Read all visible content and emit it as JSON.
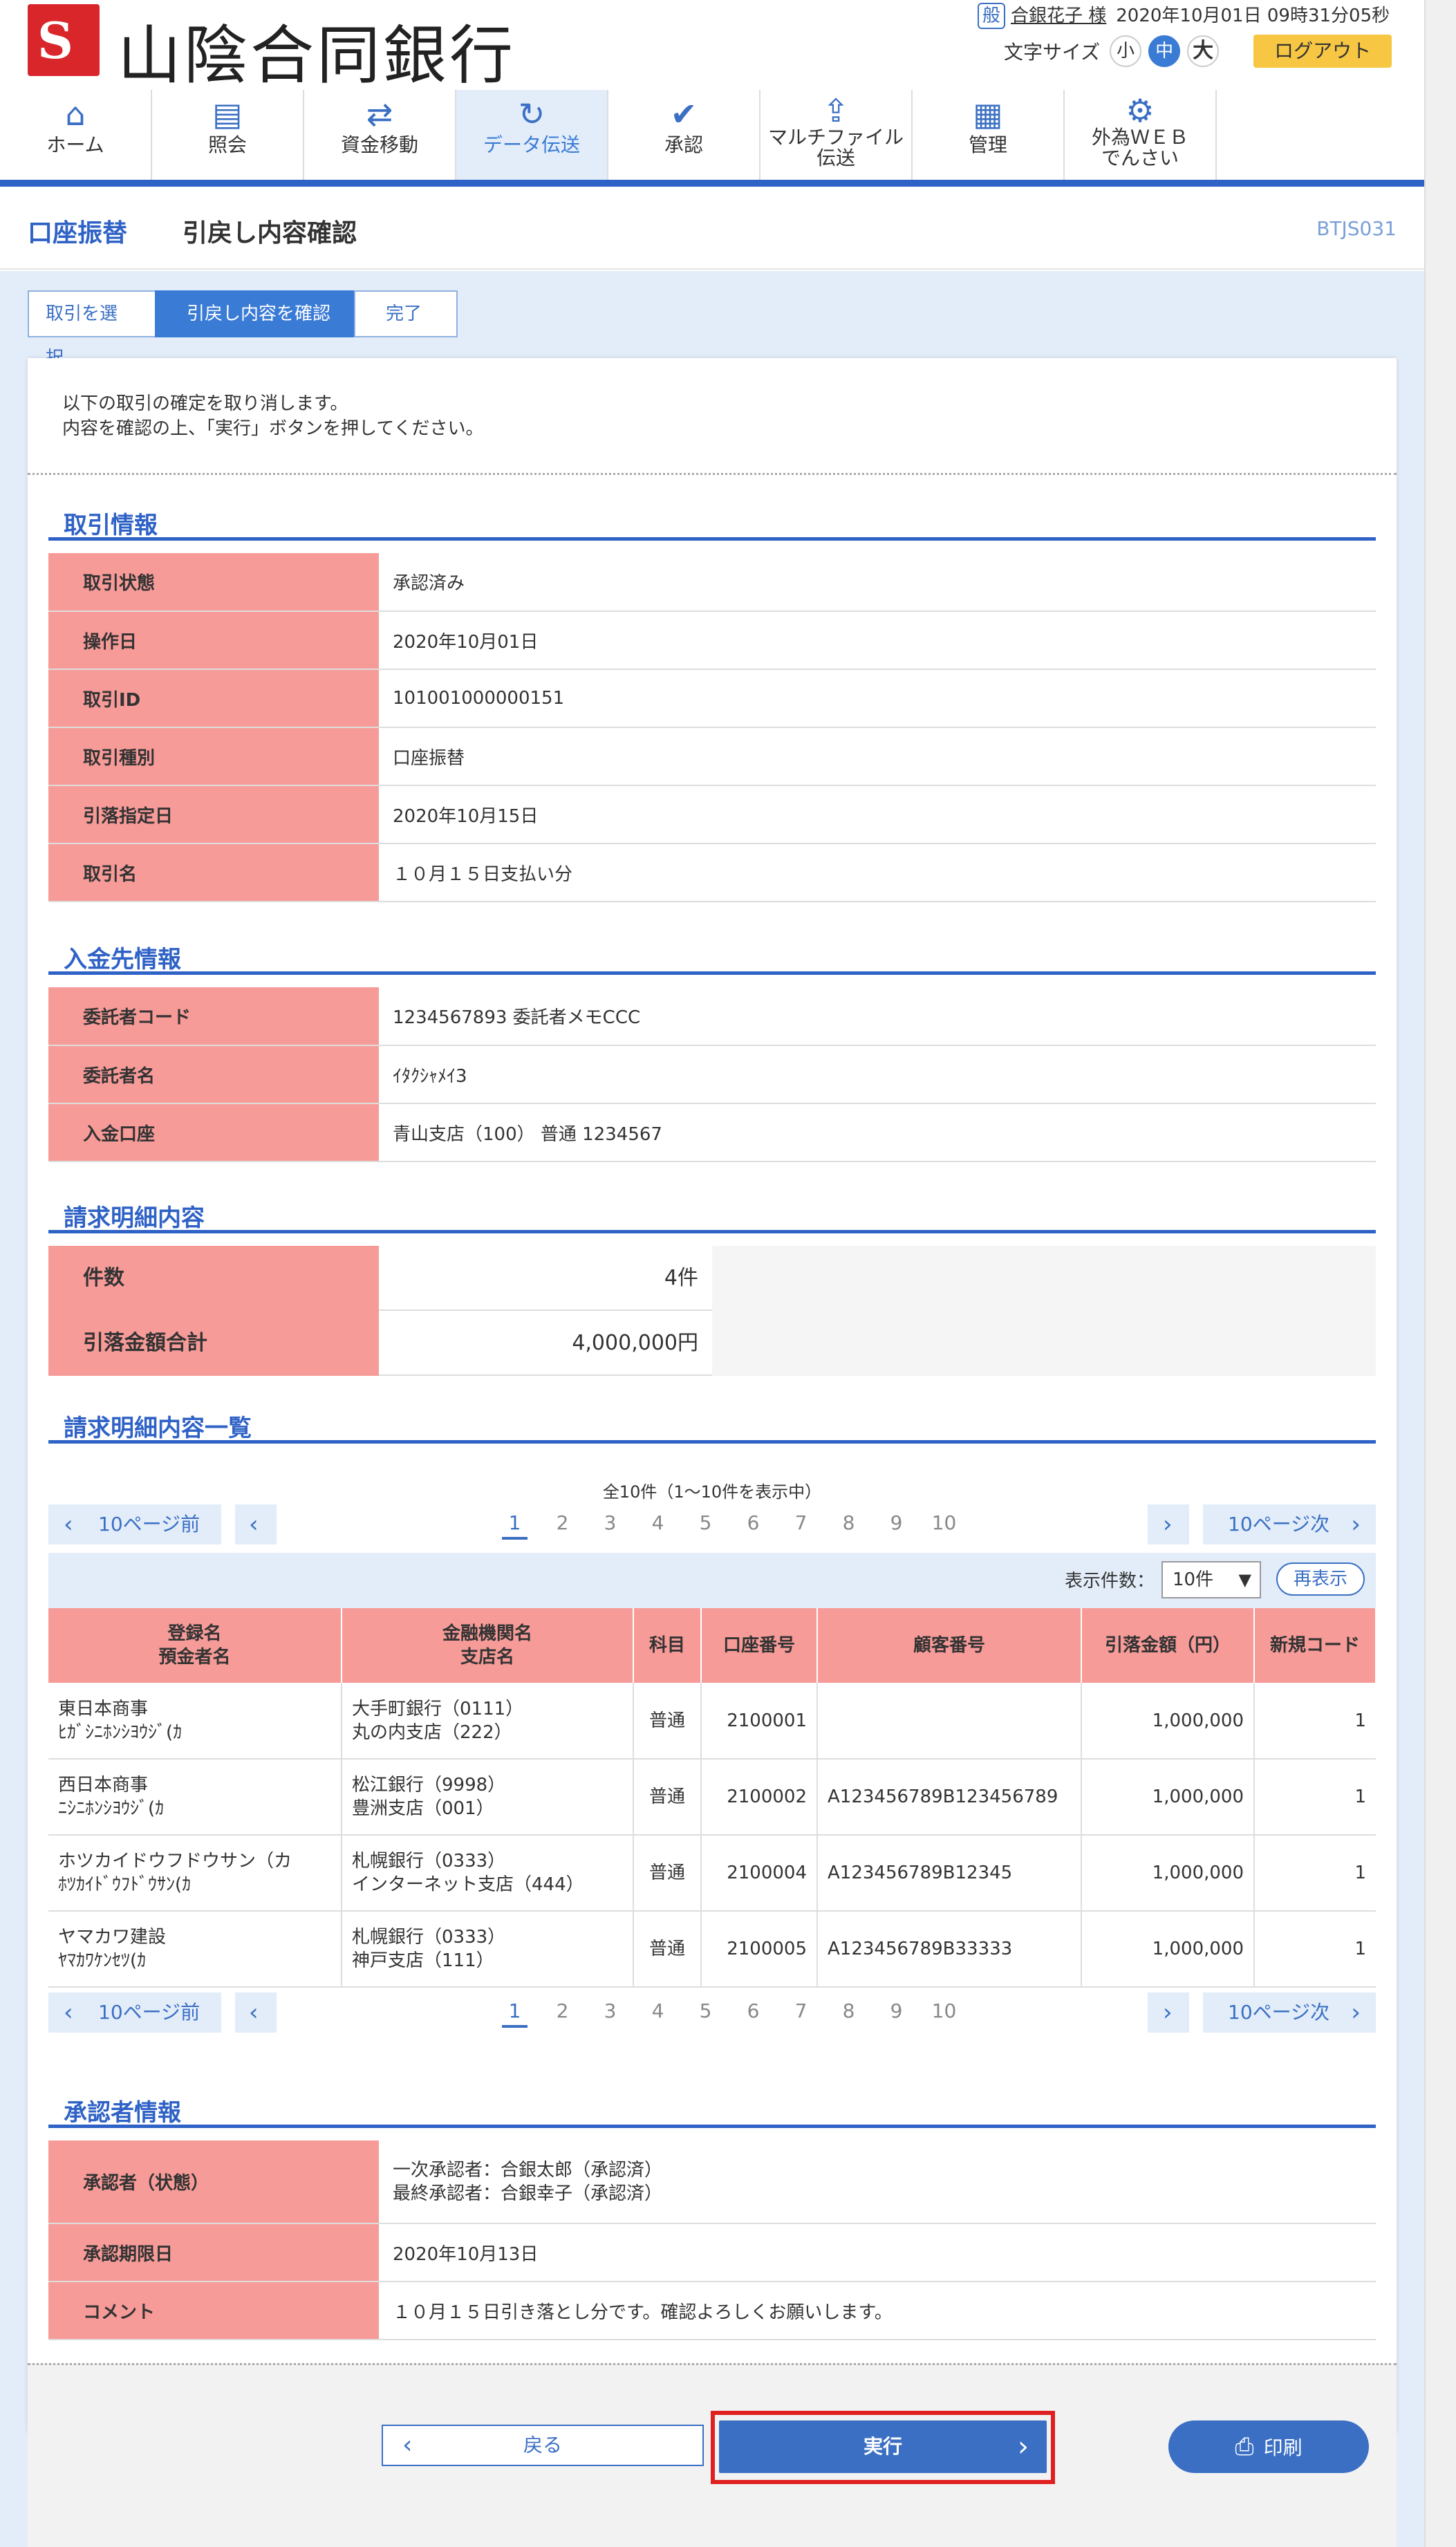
{
  "header": {
    "logo_mark": "S",
    "bank_name": "山陰合同銀行",
    "user_badge": "般",
    "user_name": "合銀花子 様",
    "datetime": "2020年10月01日 09時31分05秒",
    "font_size_label": "文字サイズ",
    "font_small": "小",
    "font_medium": "中",
    "font_large": "大",
    "logout": "ログアウト"
  },
  "nav": [
    {
      "label": "ホーム",
      "icon": "home-icon",
      "glyph": "⌂"
    },
    {
      "label": "照会",
      "icon": "document-icon",
      "glyph": "▤"
    },
    {
      "label": "資金移動",
      "icon": "transfer-icon",
      "glyph": "⇄"
    },
    {
      "label": "データ伝送",
      "icon": "sync-icon",
      "glyph": "↻"
    },
    {
      "label": "承認",
      "icon": "approve-icon",
      "glyph": "✔"
    },
    {
      "label1": "マルチファイル",
      "label2": "伝送",
      "icon": "upload-icon",
      "glyph": "⇪"
    },
    {
      "label": "管理",
      "icon": "building-icon",
      "glyph": "▦"
    },
    {
      "label1": "外為ＷＥＢ",
      "label2": "でんさい",
      "icon": "network-icon",
      "glyph": "⚙"
    }
  ],
  "title": {
    "category": "口座振替",
    "page_title": "引戻し内容確認",
    "screen_code": "BTJS031"
  },
  "steps": [
    "取引を選択",
    "引戻し内容を確認",
    "完了"
  ],
  "intro": {
    "line1": "以下の取引の確定を取り消します。",
    "line2": "内容を確認の上、「実行」ボタンを押してください。"
  },
  "transaction_info": {
    "heading": "取引情報",
    "rows": [
      {
        "label": "取引状態",
        "value": "承認済み"
      },
      {
        "label": "操作日",
        "value": "2020年10月01日"
      },
      {
        "label": "取引ID",
        "value": "101001000000151"
      },
      {
        "label": "取引種別",
        "value": "口座振替"
      },
      {
        "label": "引落指定日",
        "value": "2020年10月15日"
      },
      {
        "label": "取引名",
        "value": "１０月１５日支払い分"
      }
    ]
  },
  "deposit_info": {
    "heading": "入金先情報",
    "rows": [
      {
        "label": "委託者コード",
        "value": "1234567893 委託者メモCCC"
      },
      {
        "label": "委託者名",
        "value": "ｲﾀｸｼｬﾒｲ3"
      },
      {
        "label": "入金口座",
        "value": "青山支店（100） 普通 1234567"
      }
    ]
  },
  "billing_summary": {
    "heading": "請求明細内容",
    "count_label": "件数",
    "count_value": "4件",
    "total_label": "引落金額合計",
    "total_value": "4,000,000円"
  },
  "billing_list": {
    "heading": "請求明細内容一覧",
    "count_text": "全10件（1〜10件を表示中）",
    "prev10": "10ページ前",
    "next10": "10ページ次",
    "pages": [
      "1",
      "2",
      "3",
      "4",
      "5",
      "6",
      "7",
      "8",
      "9",
      "10"
    ],
    "display_count_label": "表示件数：",
    "display_count_value": "10件",
    "redisplay": "再表示",
    "columns": {
      "c1a": "登録名",
      "c1b": "預金者名",
      "c2a": "金融機関名",
      "c2b": "支店名",
      "c3": "科目",
      "c4": "口座番号",
      "c5": "顧客番号",
      "c6": "引落金額（円）",
      "c7": "新規コード"
    },
    "rows": [
      {
        "name": "東日本商事",
        "kana": "ﾋｶﾞｼﾆﾎﾝｼﾖｳｼﾞ(ｶ",
        "bank": "大手町銀行（0111）",
        "branch": "丸の内支店（222）",
        "type": "普通",
        "account": "2100001",
        "customer": "",
        "amount": "1,000,000",
        "code": "1"
      },
      {
        "name": "西日本商事",
        "kana": "ﾆｼﾆﾎﾝｼﾖｳｼﾞ(ｶ",
        "bank": "松江銀行（9998）",
        "branch": "豊洲支店（001）",
        "type": "普通",
        "account": "2100002",
        "customer": "A123456789B123456789",
        "amount": "1,000,000",
        "code": "1"
      },
      {
        "name": "ホツカイドウフドウサン（カ",
        "kana": "ﾎﾂｶｲﾄﾞｳﾌﾄﾞｳｻﾝ(ｶ",
        "bank": "札幌銀行（0333）",
        "branch": "インターネット支店（444）",
        "type": "普通",
        "account": "2100004",
        "customer": "A123456789B12345",
        "amount": "1,000,000",
        "code": "1"
      },
      {
        "name": "ヤマカワ建設",
        "kana": "ﾔﾏｶﾜｹﾝｾﾂ(ｶ",
        "bank": "札幌銀行（0333）",
        "branch": "神戸支店（111）",
        "type": "普通",
        "account": "2100005",
        "customer": "A123456789B33333",
        "amount": "1,000,000",
        "code": "1"
      }
    ]
  },
  "approver_info": {
    "heading": "承認者情報",
    "status_label": "承認者（状態）",
    "status_line1": "一次承認者：合銀太郎（承認済）",
    "status_line2": "最終承認者：合銀幸子（承認済）",
    "deadline_label": "承認期限日",
    "deadline_value": "2020年10月13日",
    "comment_label": "コメント",
    "comment_value": "１０月１５日引き落とし分です。確認よろしくお願いします。"
  },
  "buttons": {
    "back": "戻る",
    "execute": "実行",
    "print": "印刷"
  },
  "colors": {
    "brand_blue": "#2f62c6",
    "label_pink": "#f79b98",
    "highlight_red": "#e02020",
    "logo_red": "#d9262a",
    "logout_yellow": "#f7c743"
  }
}
